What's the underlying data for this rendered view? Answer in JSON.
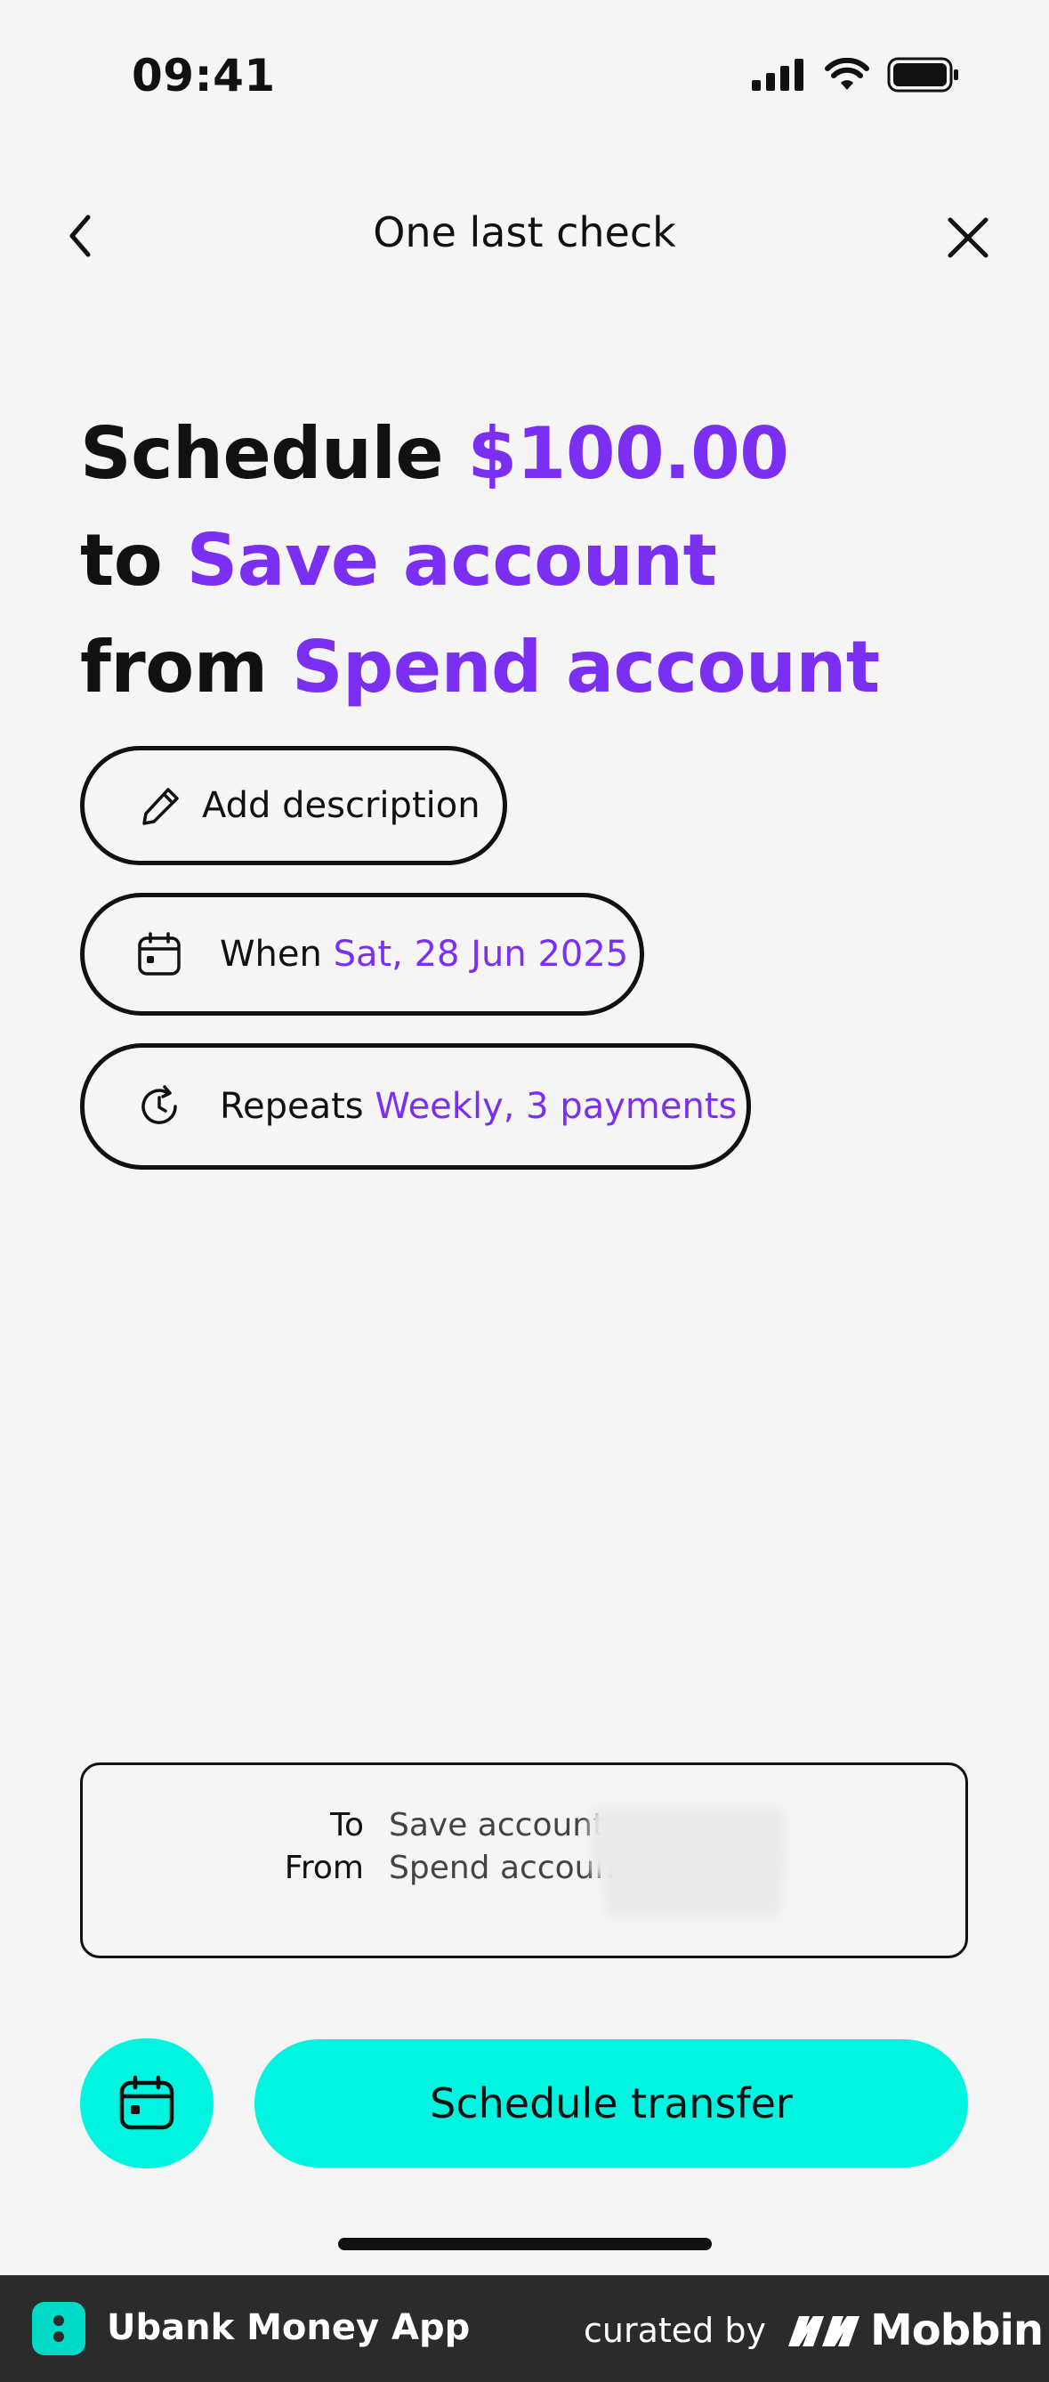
{
  "status_bar": {
    "time": "09:41"
  },
  "header": {
    "title": "One last check"
  },
  "headline": {
    "line1_prefix": "Schedule",
    "amount": "$100.00",
    "line2_prefix": "to",
    "to_account": "Save account",
    "line3_prefix": "from",
    "from_account": "Spend account"
  },
  "actions": {
    "description_label": "Add description",
    "when_label": "When",
    "when_value": "Sat, 28 Jun 2025",
    "repeats_label": "Repeats",
    "repeats_value": "Weekly, 3 payments"
  },
  "summary": {
    "to_label": "To",
    "to_value": "Save account",
    "from_label": "From",
    "from_value": "Spend accoun"
  },
  "buttons": {
    "schedule_label": "Schedule transfer"
  },
  "footer": {
    "app_name": "Ubank Money App",
    "curated_by": "curated by",
    "brand": "Mobbin"
  },
  "colors": {
    "accent": "#7b2ff2",
    "primary_button": "#00f5e0",
    "background": "#f5f5f5"
  }
}
